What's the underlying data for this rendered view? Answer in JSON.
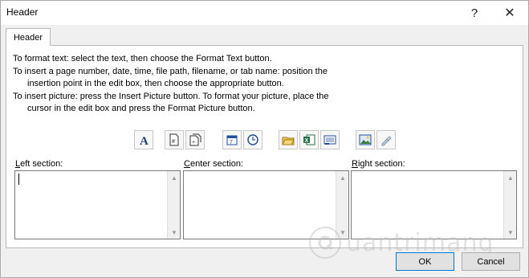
{
  "window": {
    "title": "Header",
    "help_glyph": "?",
    "close_glyph": "✕"
  },
  "tab": {
    "label": "Header"
  },
  "instructions": [
    "To format text:  select the text, then choose the Format Text button.",
    "To insert a page number, date, time, file path, filename, or tab name:  position the",
    "insertion point in the edit box, then choose the appropriate button.",
    "To insert picture: press the Insert Picture button.  To format your picture, place the",
    "cursor in the edit box and press the Format Picture button."
  ],
  "toolbar_icons": [
    "format-text-icon",
    "insert-page-number-icon",
    "insert-number-of-pages-icon",
    "insert-date-icon",
    "insert-time-icon",
    "insert-file-path-icon",
    "insert-filename-icon",
    "insert-sheet-name-icon",
    "insert-picture-icon",
    "format-picture-icon"
  ],
  "sections": {
    "left": {
      "label_pre": "",
      "label_key": "L",
      "label_post": "eft section:",
      "value": ""
    },
    "center": {
      "label_pre": "",
      "label_key": "C",
      "label_post": "enter section:",
      "value": ""
    },
    "right": {
      "label_pre": "",
      "label_key": "R",
      "label_post": "ight section:",
      "value": ""
    }
  },
  "buttons": {
    "ok": "OK",
    "cancel": "Cancel"
  },
  "watermark": {
    "text": "uantrimang"
  },
  "colors": {
    "accent": "#0078d7",
    "panel": "#ffffff",
    "dialog_bg": "#f0f0f0"
  }
}
